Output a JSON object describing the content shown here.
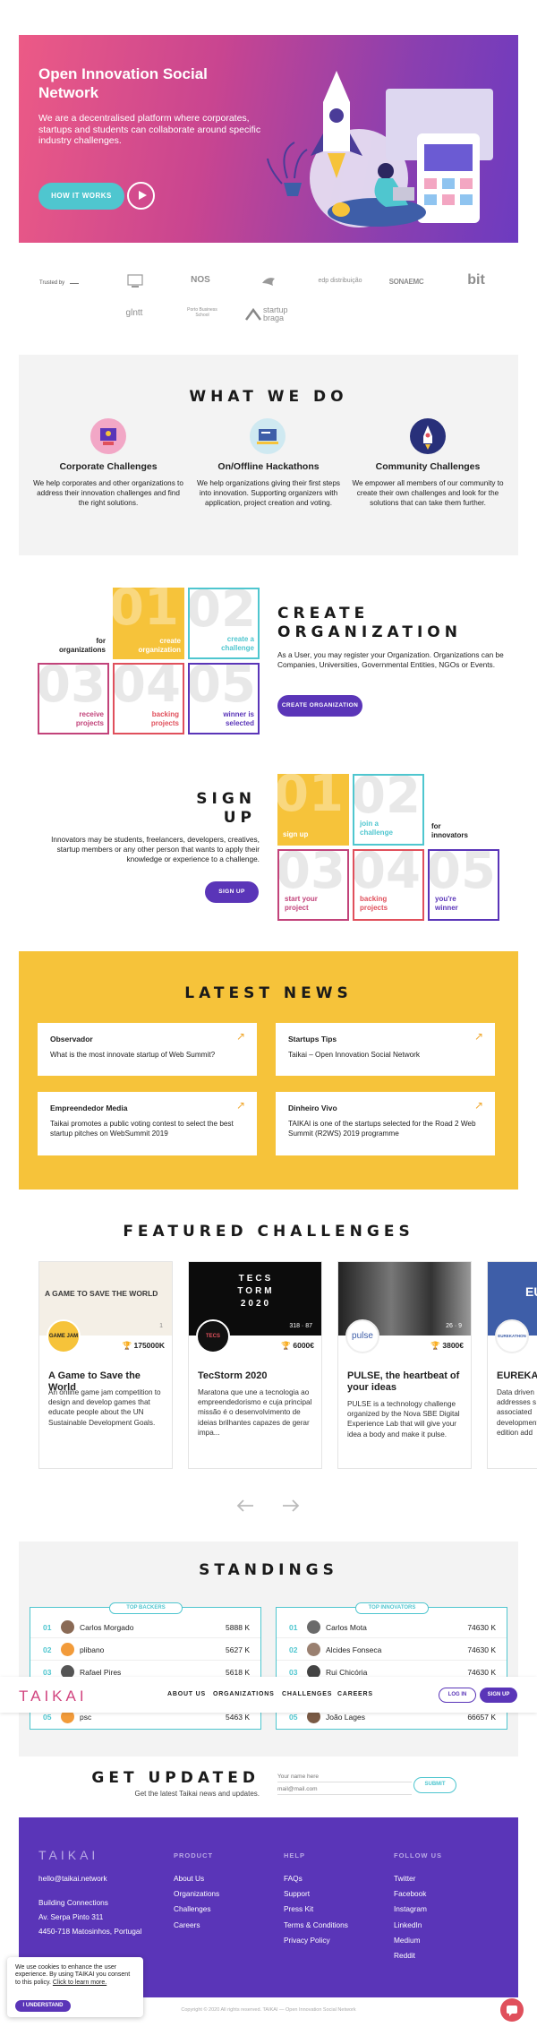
{
  "hero": {
    "title": "Open Innovation Social Network",
    "description": "We are a decentralised platform where corporates, startups and students can collaborate around specific industry challenges.",
    "cta_label": "HOW IT WORKS"
  },
  "trusted": {
    "label": "Trusted by",
    "logos": [
      "NOS",
      "edp distribuição",
      "SONAEMC",
      "bit",
      "glntt",
      "Porto Business School",
      "startup braga"
    ]
  },
  "what_we_do": {
    "heading": "WHAT WE DO",
    "items": [
      {
        "title": "Corporate Challenges",
        "text": "We help corporates and other organizations to address their innovation challenges and find the right solutions."
      },
      {
        "title": "On/Offline Hackathons",
        "text": "We help organizations giving their first steps into innovation. Supporting organizers with application, project creation and voting."
      },
      {
        "title": "Community Challenges",
        "text": "We empower all members of our community to create their own challenges and look for the solutions that can take them further."
      }
    ]
  },
  "create_org": {
    "heading_line1": "CREATE",
    "heading_line2": "ORGANIZATION",
    "text": "As a User, you may register your Organization. Organizations can be Companies, Universities, Governmental Entities, NGOs or Events.",
    "button": "CREATE ORGANIZATION",
    "side_label": "for organizations",
    "tiles": [
      {
        "num": "01",
        "label": "create organization"
      },
      {
        "num": "02",
        "label": "create a challenge"
      },
      {
        "num": "03",
        "label": "receive projects"
      },
      {
        "num": "04",
        "label": "backing projects"
      },
      {
        "num": "05",
        "label": "winner is selected"
      }
    ]
  },
  "signup": {
    "heading_line1": "SIGN",
    "heading_line2": "UP",
    "text": "Innovators may be students, freelancers, developers, creatives, startup members or any other person that wants to apply their knowledge or experience to a challenge.",
    "button": "SIGN UP",
    "side_label": "for innovators",
    "tiles": [
      {
        "num": "01",
        "label": "sign up"
      },
      {
        "num": "02",
        "label": "join a challenge"
      },
      {
        "num": "03",
        "label": "start your project"
      },
      {
        "num": "04",
        "label": "backing projects"
      },
      {
        "num": "05",
        "label": "you're winner"
      }
    ]
  },
  "news": {
    "heading": "LATEST NEWS",
    "items": [
      {
        "source": "Observador",
        "title": "What is the most innovate startup of Web Summit?"
      },
      {
        "source": "Startups Tips",
        "title": "Taikai – Open Innovation Social Network"
      },
      {
        "source": "Empreendedor Media",
        "title": "Taikai promotes a public voting contest to select the best startup pitches on WebSummit 2019"
      },
      {
        "source": "Dinheiro Vivo",
        "title": "TAIKAI is one of the startups selected for the Road 2 Web Summit (R2WS) 2019 programme"
      }
    ]
  },
  "challenges": {
    "heading": "FEATURED CHALLENGES",
    "items": [
      {
        "banner": "A GAME TO SAVE THE WORLD",
        "logo": "GAME JAM",
        "stats": "1",
        "prize": "175000K",
        "title": "A Game to Save the World",
        "desc": "An online game jam competition to design and develop games that educate people about the UN Sustainable Development Goals."
      },
      {
        "banner": "TECS TORM 2020",
        "logo": "TECS",
        "stats": "318 · 87",
        "prize": "6000€",
        "title": "TecStorm 2020",
        "desc": "Maratona que une a tecnologia ao empreendedorismo e cuja principal missão é o desenvolvimento de ideias brilhantes capazes de gerar impa..."
      },
      {
        "banner": "",
        "logo": "pulse",
        "stats": "26 · 9",
        "prize": "3800€",
        "title": "PULSE, the heartbeat of your ideas",
        "desc": "PULSE is a technology challenge organized by the Nova SBE Digital Experience Lab that will give your idea a body and make it pulse."
      },
      {
        "banner": "EU",
        "logo": "EUREKATHON",
        "stats": "",
        "prize": "",
        "title": "EUREKATH",
        "desc": "Data driven addresses s associated development edition add"
      }
    ]
  },
  "standings": {
    "heading": "STANDINGS",
    "backers": {
      "tag": "TOP BACKERS",
      "rows": [
        {
          "rank": "01",
          "name": "Carlos Morgado",
          "score": "5888 K"
        },
        {
          "rank": "02",
          "name": "plibano",
          "score": "5627 K"
        },
        {
          "rank": "03",
          "name": "Rafael Pires",
          "score": "5618 K"
        },
        {
          "rank": "05",
          "name": "psc",
          "score": "5463 K"
        }
      ]
    },
    "innovators": {
      "tag": "TOP INNOVATORS",
      "rows": [
        {
          "rank": "01",
          "name": "Carlos Mota",
          "score": "74630 K"
        },
        {
          "rank": "02",
          "name": "Alcides Fonseca",
          "score": "74630 K"
        },
        {
          "rank": "03",
          "name": "Rui Chicória",
          "score": "74630 K"
        },
        {
          "rank": "05",
          "name": "João Lages",
          "score": "66657 K"
        }
      ]
    }
  },
  "nav": {
    "logo": "TAIKAI",
    "links": [
      "ABOUT US",
      "ORGANIZATIONS",
      "CHALLENGES",
      "CAREERS"
    ],
    "login": "LOG IN",
    "signup": "SIGN UP"
  },
  "updated": {
    "heading": "GET UPDATED",
    "sub": "Get the latest Taikai news and updates.",
    "name_placeholder": "Your name here",
    "email_placeholder": "mail@mail.com",
    "button": "SUBMIT"
  },
  "footer": {
    "logo": "TAIKAI",
    "email": "hello@taikai.network",
    "address": [
      "Building Connections",
      "Av. Serpa Pinto 311",
      "4450-718 Matosinhos, Portugal"
    ],
    "product": {
      "title": "PRODUCT",
      "links": [
        "About Us",
        "Organizations",
        "Challenges",
        "Careers"
      ]
    },
    "help": {
      "title": "HELP",
      "links": [
        "FAQs",
        "Support",
        "Press Kit",
        "Terms & Conditions",
        "Privacy Policy"
      ]
    },
    "follow": {
      "title": "FOLLOW US",
      "links": [
        "Twitter",
        "Facebook",
        "Instagram",
        "LinkedIn",
        "Medium",
        "Reddit"
      ]
    }
  },
  "cookie": {
    "text": "We use cookies to enhance the user experience. By using TAIKAI you consent to this policy.",
    "link": "Click to learn more.",
    "button": "I UNDERSTAND"
  },
  "copyright": "Copyright © 2020 All rights reserved. TAIKAI — Open Innovation Social Network",
  "colors": {
    "brand_purple": "#5a35b8",
    "accent_cyan": "#4fc6cf",
    "accent_yellow": "#f6c33a",
    "brand_pink": "#d1447f"
  }
}
